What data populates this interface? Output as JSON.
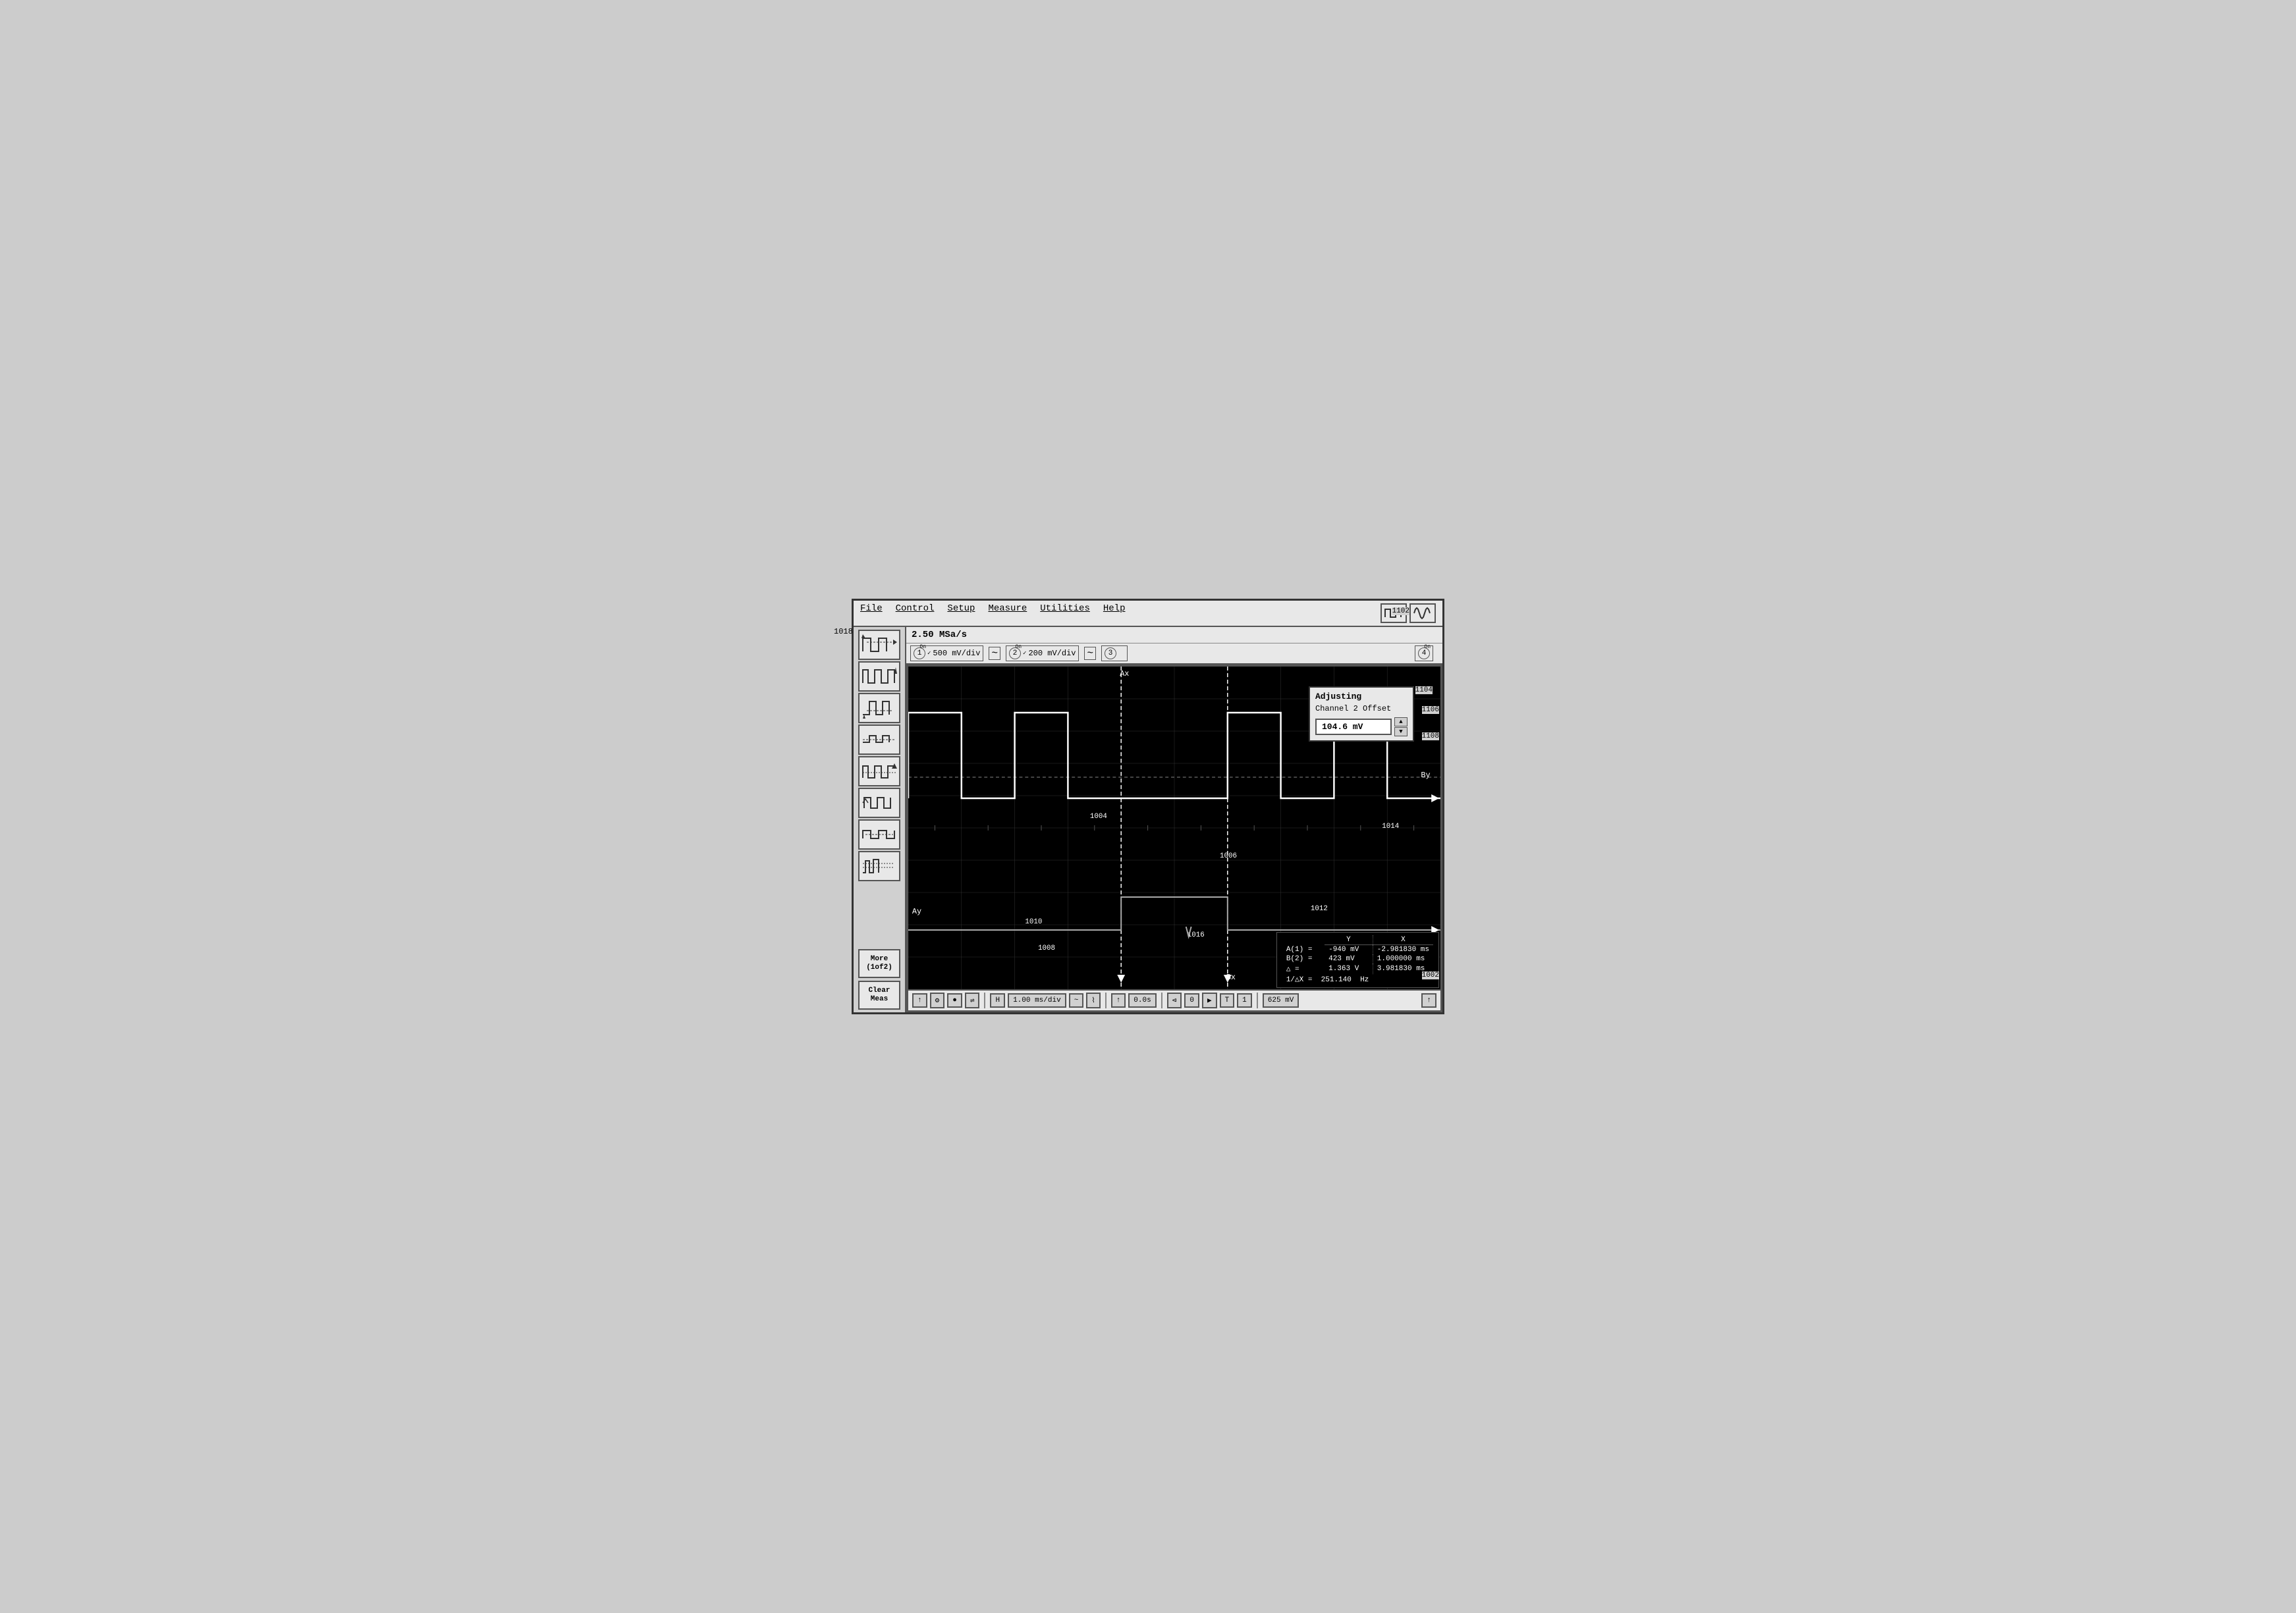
{
  "menu": {
    "items": [
      "File",
      "Control",
      "Setup",
      "Measure",
      "Utilities",
      "Help"
    ]
  },
  "header": {
    "sample_rate": "2.50 MSa/s"
  },
  "channels": [
    {
      "num": "1",
      "on": "On",
      "scale": "500 mV/div"
    },
    {
      "num": "2",
      "on": "On",
      "scale": "200 mV/div"
    },
    {
      "num": "3",
      "on": "",
      "scale": ""
    },
    {
      "num": "4",
      "on": "On",
      "scale": ""
    }
  ],
  "adjust_popup": {
    "title": "Adjusting",
    "subtitle": "Channel 2 Offset",
    "value": "104.6 mV"
  },
  "markers": {
    "ax": "Ax",
    "ay": "Ay",
    "bx": "Bx",
    "by": "By"
  },
  "measurements": {
    "header_y": "Y",
    "header_x": "X",
    "row_a_label": "A(1) =",
    "row_a_y": "-940 mV",
    "row_a_x": "-2.981830 ms",
    "row_b_label": "B(2) =",
    "row_b_y": "423 mV",
    "row_b_x": "1.000000 ms",
    "row_delta_label": "△ =",
    "row_delta_y": "1.363 V",
    "row_delta_x": "3.981830 ms",
    "row_inv_label": "1/△X =",
    "row_inv_val": "251.140",
    "row_inv_unit": "Hz"
  },
  "bottom_toolbar": {
    "timebase_label": "H",
    "timebase_value": "1.00 ms/div",
    "position_value": "0.0s",
    "offset_value": "625 mV"
  },
  "sidebar_buttons": [
    "waveform-1",
    "waveform-2",
    "waveform-3",
    "waveform-4",
    "waveform-5",
    "waveform-6",
    "waveform-7",
    "waveform-8"
  ],
  "ref_labels": {
    "r1018": "1018",
    "r1002": "1002",
    "r1004": "1004",
    "r1006": "1006",
    "r1008": "1008",
    "r1010": "1010",
    "r1012": "1012",
    "r1014": "1014",
    "r1016": "1016",
    "r1102": "1102",
    "r1104": "1104",
    "r1106": "1106",
    "r1108": "1108"
  },
  "clear_meas_label": "Clear\nMeas",
  "more_label": "More\n(1of2)"
}
